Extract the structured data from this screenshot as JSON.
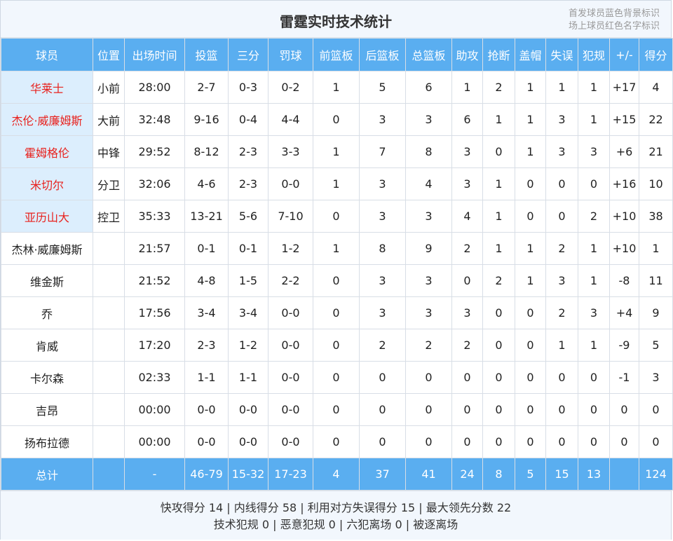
{
  "title": "雷霆实时技术统计",
  "legend": {
    "line1": "首发球员蓝色背景标识",
    "line2": "场上球员红色名字标识"
  },
  "colors": {
    "header_bg": "#5aaef0",
    "starter_bg": "#dceefd",
    "on_court_name": "#e8211d"
  },
  "columns": [
    "球员",
    "位置",
    "出场时间",
    "投篮",
    "三分",
    "罚球",
    "前篮板",
    "后篮板",
    "总篮板",
    "助攻",
    "抢断",
    "盖帽",
    "失误",
    "犯规",
    "+/-",
    "得分"
  ],
  "rows": [
    {
      "starter": true,
      "cells": [
        "华莱士",
        "小前",
        "28:00",
        "2-7",
        "0-3",
        "0-2",
        "1",
        "5",
        "6",
        "1",
        "2",
        "1",
        "1",
        "1",
        "+17",
        "4"
      ]
    },
    {
      "starter": true,
      "cells": [
        "杰伦·威廉姆斯",
        "大前",
        "32:48",
        "9-16",
        "0-4",
        "4-4",
        "0",
        "3",
        "3",
        "6",
        "1",
        "1",
        "3",
        "1",
        "+15",
        "22"
      ]
    },
    {
      "starter": true,
      "cells": [
        "霍姆格伦",
        "中锋",
        "29:52",
        "8-12",
        "2-3",
        "3-3",
        "1",
        "7",
        "8",
        "3",
        "0",
        "1",
        "3",
        "3",
        "+6",
        "21"
      ]
    },
    {
      "starter": true,
      "cells": [
        "米切尔",
        "分卫",
        "32:06",
        "4-6",
        "2-3",
        "0-0",
        "1",
        "3",
        "4",
        "3",
        "1",
        "0",
        "0",
        "0",
        "+16",
        "10"
      ]
    },
    {
      "starter": true,
      "cells": [
        "亚历山大",
        "控卫",
        "35:33",
        "13-21",
        "5-6",
        "7-10",
        "0",
        "3",
        "3",
        "4",
        "1",
        "0",
        "0",
        "2",
        "+10",
        "38"
      ]
    },
    {
      "starter": false,
      "cells": [
        "杰林·威廉姆斯",
        "",
        "21:57",
        "0-1",
        "0-1",
        "1-2",
        "1",
        "8",
        "9",
        "2",
        "1",
        "1",
        "2",
        "1",
        "+10",
        "1"
      ]
    },
    {
      "starter": false,
      "cells": [
        "维金斯",
        "",
        "21:52",
        "4-8",
        "1-5",
        "2-2",
        "0",
        "3",
        "3",
        "0",
        "2",
        "1",
        "3",
        "1",
        "-8",
        "11"
      ]
    },
    {
      "starter": false,
      "cells": [
        "乔",
        "",
        "17:56",
        "3-4",
        "3-4",
        "0-0",
        "0",
        "3",
        "3",
        "3",
        "0",
        "0",
        "2",
        "3",
        "+4",
        "9"
      ]
    },
    {
      "starter": false,
      "cells": [
        "肯威",
        "",
        "17:20",
        "2-3",
        "1-2",
        "0-0",
        "0",
        "2",
        "2",
        "2",
        "0",
        "0",
        "1",
        "1",
        "-9",
        "5"
      ]
    },
    {
      "starter": false,
      "cells": [
        "卡尔森",
        "",
        "02:33",
        "1-1",
        "1-1",
        "0-0",
        "0",
        "0",
        "0",
        "0",
        "0",
        "0",
        "0",
        "0",
        "-1",
        "3"
      ]
    },
    {
      "starter": false,
      "cells": [
        "吉昂",
        "",
        "00:00",
        "0-0",
        "0-0",
        "0-0",
        "0",
        "0",
        "0",
        "0",
        "0",
        "0",
        "0",
        "0",
        "0",
        "0"
      ]
    },
    {
      "starter": false,
      "cells": [
        "扬布拉德",
        "",
        "00:00",
        "0-0",
        "0-0",
        "0-0",
        "0",
        "0",
        "0",
        "0",
        "0",
        "0",
        "0",
        "0",
        "0",
        "0"
      ]
    }
  ],
  "totals": [
    "总计",
    "",
    "-",
    "46-79",
    "15-32",
    "17-23",
    "4",
    "37",
    "41",
    "24",
    "8",
    "5",
    "15",
    "13",
    "",
    "124"
  ],
  "footer": {
    "line1": "快攻得分 14 | 内线得分 58 | 利用对方失误得分 15 | 最大领先分数 22",
    "line2": "技术犯规 0 | 恶意犯规 0 | 六犯离场 0 | 被逐离场"
  }
}
